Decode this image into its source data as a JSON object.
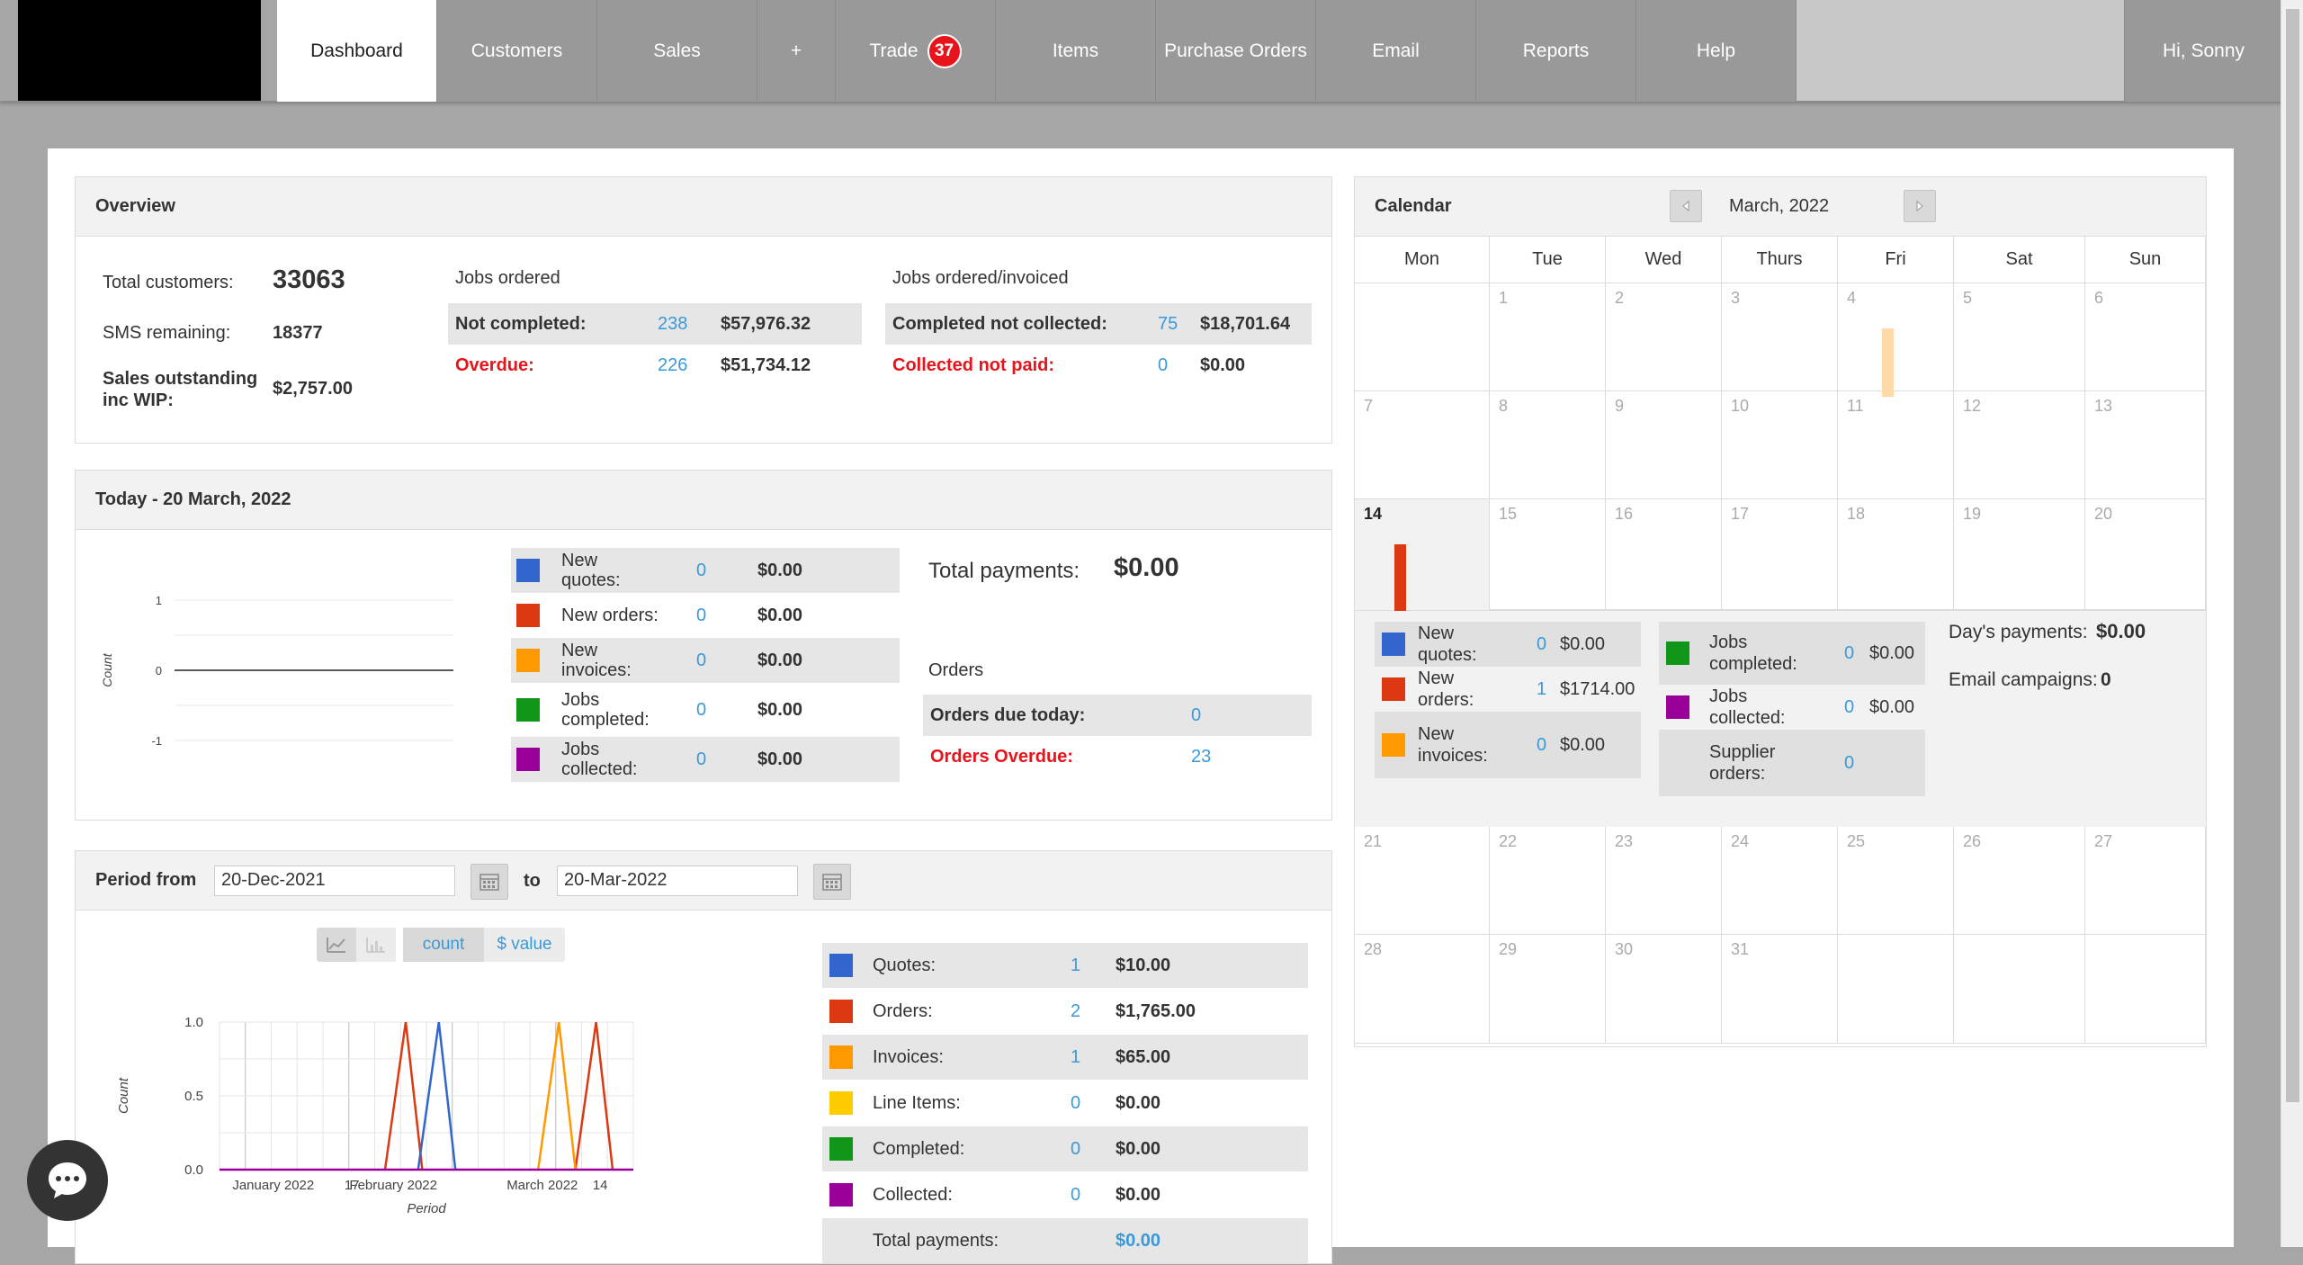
{
  "nav": {
    "items": [
      {
        "label": "Dashboard",
        "active": true
      },
      {
        "label": "Customers"
      },
      {
        "label": "Sales"
      },
      {
        "label": "+"
      },
      {
        "label": "Trade",
        "badge": "37"
      },
      {
        "label": "Items"
      },
      {
        "label": "Purchase Orders"
      },
      {
        "label": "Email"
      },
      {
        "label": "Reports"
      },
      {
        "label": "Help"
      }
    ],
    "user": "Hi, Sonny"
  },
  "overview": {
    "title": "Overview",
    "total_customers_label": "Total customers:",
    "total_customers": "33063",
    "sms_label": "SMS remaining:",
    "sms": "18377",
    "sales_outstanding_label": "Sales outstanding inc WIP:",
    "sales_outstanding": "$2,757.00",
    "jobs_ordered_title": "Jobs ordered",
    "not_completed_label": "Not completed:",
    "not_completed_count": "238",
    "not_completed_amount": "$57,976.32",
    "overdue_label": "Overdue:",
    "overdue_count": "226",
    "overdue_amount": "$51,734.12",
    "jobs_invoiced_title": "Jobs ordered/invoiced",
    "completed_not_collected_label": "Completed not collected:",
    "completed_not_collected_count": "75",
    "completed_not_collected_amount": "$18,701.64",
    "collected_not_paid_label": "Collected not paid:",
    "collected_not_paid_count": "0",
    "collected_not_paid_amount": "$0.00"
  },
  "today": {
    "title": "Today - 20 March, 2022",
    "chart_ylabel": "Count",
    "rows": [
      {
        "label": "New quotes:",
        "count": "0",
        "amount": "$0.00",
        "color": "#3366cc"
      },
      {
        "label": "New orders:",
        "count": "0",
        "amount": "$0.00",
        "color": "#dc3912"
      },
      {
        "label": "New invoices:",
        "count": "0",
        "amount": "$0.00",
        "color": "#ff9900"
      },
      {
        "label": "Jobs completed:",
        "count": "0",
        "amount": "$0.00",
        "color": "#109618"
      },
      {
        "label": "Jobs collected:",
        "count": "0",
        "amount": "$0.00",
        "color": "#990099"
      }
    ],
    "total_payments_label": "Total payments:",
    "total_payments": "$0.00",
    "orders_title": "Orders",
    "orders_due_label": "Orders due today:",
    "orders_due": "0",
    "orders_overdue_label": "Orders Overdue:",
    "orders_overdue": "23"
  },
  "period": {
    "label": "Period from",
    "from": "20-Dec-2021",
    "to_label": "to",
    "to": "20-Mar-2022",
    "toggle_count": "count",
    "toggle_value": "$ value",
    "rows": [
      {
        "label": "Quotes:",
        "count": "1",
        "amount": "$10.00",
        "color": "#3366cc"
      },
      {
        "label": "Orders:",
        "count": "2",
        "amount": "$1,765.00",
        "color": "#dc3912"
      },
      {
        "label": "Invoices:",
        "count": "1",
        "amount": "$65.00",
        "color": "#ff9900"
      },
      {
        "label": "Line Items:",
        "count": "0",
        "amount": "$0.00",
        "color": "#ffcc00"
      },
      {
        "label": "Completed:",
        "count": "0",
        "amount": "$0.00",
        "color": "#109618"
      },
      {
        "label": "Collected:",
        "count": "0",
        "amount": "$0.00",
        "color": "#990099"
      }
    ],
    "total_label": "Total payments:",
    "total_value": "$0.00"
  },
  "chart_data": [
    {
      "type": "line",
      "xlabel": "",
      "ylabel": "Count",
      "ylim": [
        -1,
        1
      ],
      "yticks": [
        "1",
        "0",
        "-1"
      ],
      "series": [
        {
          "values": [
            0,
            0
          ]
        }
      ]
    },
    {
      "type": "line",
      "xlabel": "Period",
      "ylabel": "Count",
      "ylim": [
        0,
        1
      ],
      "yticks": [
        "1.0",
        "0.5",
        "0.0"
      ],
      "xticks": [
        "January 2022",
        "17",
        "February 2022",
        "March 2022",
        "14"
      ],
      "series": [
        {
          "color": "#dc3912",
          "points": [
            [
              0.4,
              0
            ],
            [
              0.45,
              1
            ],
            [
              0.49,
              0
            ],
            [
              0.86,
              0
            ],
            [
              0.91,
              1
            ],
            [
              0.95,
              0
            ]
          ]
        },
        {
          "color": "#3366cc",
          "points": [
            [
              0.48,
              0
            ],
            [
              0.53,
              1
            ],
            [
              0.57,
              0
            ]
          ]
        },
        {
          "color": "#ff9900",
          "points": [
            [
              0.77,
              0
            ],
            [
              0.82,
              1
            ],
            [
              0.86,
              0
            ]
          ]
        },
        {
          "color": "#990099",
          "points": [
            [
              0.0,
              0
            ],
            [
              1.0,
              0
            ]
          ]
        }
      ]
    }
  ],
  "calendar": {
    "title": "Calendar",
    "month": "March, 2022",
    "days": [
      "Mon",
      "Tue",
      "Wed",
      "Thurs",
      "Fri",
      "Sat",
      "Sun"
    ],
    "weeks": [
      [
        "",
        "1",
        "2",
        "3",
        "4",
        "5",
        "6"
      ],
      [
        "7",
        "8",
        "9",
        "10",
        "11",
        "12",
        "13"
      ],
      [
        "14",
        "15",
        "16",
        "17",
        "18",
        "19",
        "20"
      ],
      [
        "21",
        "22",
        "23",
        "24",
        "25",
        "26",
        "27"
      ],
      [
        "28",
        "29",
        "30",
        "31",
        "",
        "",
        ""
      ]
    ],
    "selected_day": "14",
    "detail_left": [
      {
        "label": "New quotes:",
        "count": "0",
        "amount": "$0.00",
        "color": "#3366cc"
      },
      {
        "label": "New orders:",
        "count": "1",
        "amount": "$1714.00",
        "color": "#dc3912"
      },
      {
        "label": "New invoices:",
        "count": "0",
        "amount": "$0.00",
        "color": "#ff9900"
      }
    ],
    "detail_mid": [
      {
        "label": "Jobs completed:",
        "count": "0",
        "amount": "$0.00",
        "color": "#109618"
      },
      {
        "label": "Jobs collected:",
        "count": "0",
        "amount": "$0.00",
        "color": "#990099"
      },
      {
        "label": "Supplier orders:",
        "count": "0",
        "amount": "",
        "color": ""
      }
    ],
    "days_payments_label": "Day's payments:",
    "days_payments": "$0.00",
    "email_campaigns_label": "Email campaigns:",
    "email_campaigns": "0"
  }
}
